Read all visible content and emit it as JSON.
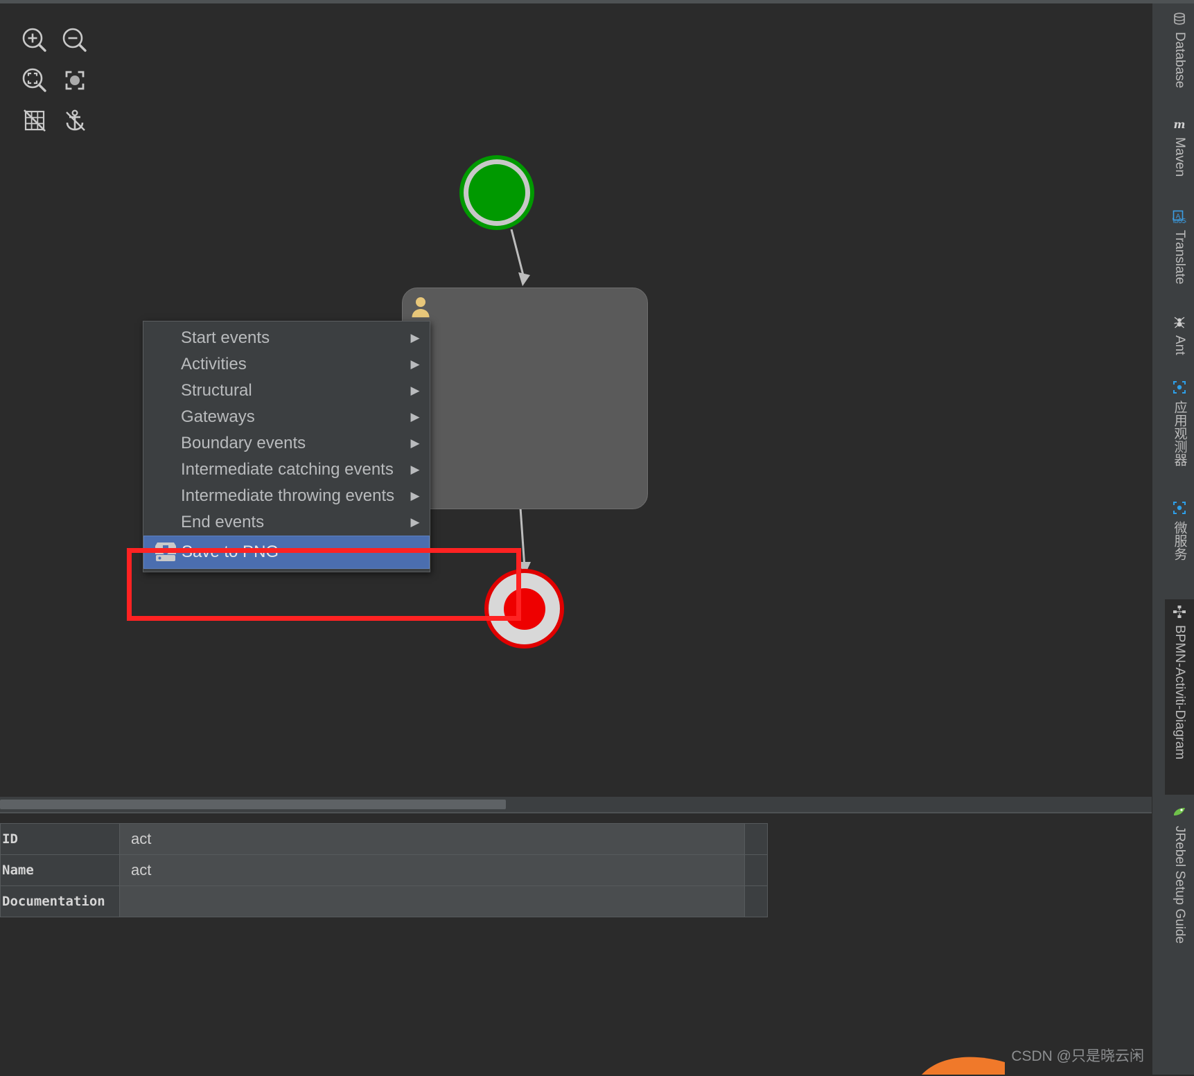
{
  "app": {
    "theme_bg": "#2b2b2b",
    "accent_selection": "#4b6eaf",
    "annotation_color": "#ff2222"
  },
  "toolbar": {
    "items": [
      {
        "name": "zoom-in-icon",
        "tooltip": "Zoom In"
      },
      {
        "name": "zoom-out-icon",
        "tooltip": "Zoom Out"
      },
      {
        "name": "zoom-actual-icon",
        "tooltip": "Actual Size"
      },
      {
        "name": "fit-content-icon",
        "tooltip": "Fit Content"
      },
      {
        "name": "toggle-grid-icon",
        "tooltip": "Toggle Grid"
      },
      {
        "name": "toggle-snap-icon",
        "tooltip": "Toggle Snap"
      }
    ]
  },
  "context_menu": {
    "items": [
      {
        "label": "Start events",
        "submenu": true,
        "selected": false
      },
      {
        "label": "Activities",
        "submenu": true,
        "selected": false
      },
      {
        "label": "Structural",
        "submenu": true,
        "selected": false
      },
      {
        "label": "Gateways",
        "submenu": true,
        "selected": false
      },
      {
        "label": "Boundary events",
        "submenu": true,
        "selected": false
      },
      {
        "label": "Intermediate catching events",
        "submenu": true,
        "selected": false
      },
      {
        "label": "Intermediate throwing events",
        "submenu": true,
        "selected": false
      },
      {
        "label": "End events",
        "submenu": true,
        "selected": false
      },
      {
        "label": "Save to PNG",
        "submenu": false,
        "selected": true,
        "icon": "save-to-png-icon"
      }
    ],
    "submenu_arrow": "▶"
  },
  "diagram": {
    "nodes": [
      {
        "type": "start-event",
        "name": "start-event-node",
        "fill": "#009900",
        "ring": "#c8c8c8"
      },
      {
        "type": "user-task",
        "name": "user-task-node",
        "fill": "#5a5a5a",
        "icon": "user-icon",
        "icon_color": "#e8c77a",
        "label": ""
      },
      {
        "type": "end-event",
        "name": "end-event-node",
        "fill": "#ee0000",
        "ring": "#d8d8d8"
      }
    ],
    "flows": [
      {
        "name": "sequence-flow-start-to-task"
      },
      {
        "name": "sequence-flow-task-to-end"
      }
    ]
  },
  "properties": {
    "rows": [
      {
        "label": "ID",
        "value": "act"
      },
      {
        "label": "Name",
        "value": "act"
      },
      {
        "label": "Documentation",
        "value": ""
      }
    ]
  },
  "right_rail": {
    "tabs": [
      {
        "label": "Database",
        "icon": "database-icon",
        "active": false
      },
      {
        "label": "Maven",
        "icon": "maven-icon",
        "active": false
      },
      {
        "label": "Translate",
        "icon": "translate-icon",
        "active": false
      },
      {
        "label": "Ant",
        "icon": "ant-icon",
        "active": false
      },
      {
        "label": "应用观测器",
        "icon": "app-observer-icon",
        "active": false
      },
      {
        "label": "微服务",
        "icon": "microservice-icon",
        "active": false
      },
      {
        "label": "BPMN-Activiti-Diagram",
        "icon": "bpmn-diagram-icon",
        "active": true
      },
      {
        "label": "JRebel Setup Guide",
        "icon": "jrebel-icon",
        "active": false
      }
    ]
  },
  "watermark": {
    "text": "CSDN @只是晓云闲"
  }
}
